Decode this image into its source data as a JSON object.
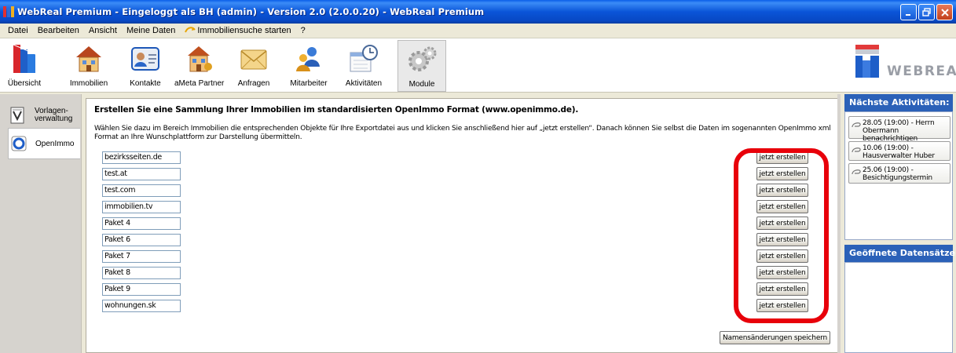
{
  "window": {
    "title": "WebReal Premium - Eingeloggt als  BH (admin) - Version 2.0 (2.0.0.20) - WebReal Premium",
    "controls": [
      "minimize",
      "maximize",
      "close"
    ]
  },
  "menu": {
    "items": [
      "Datei",
      "Bearbeiten",
      "Ansicht",
      "Meine Daten",
      "Immobiliensuche starten",
      "?"
    ]
  },
  "toolbar": {
    "items": [
      {
        "label": "Übersicht",
        "icon": "overview-icon"
      },
      {
        "label": "Immobilien",
        "icon": "house-icon"
      },
      {
        "label": "Kontakte",
        "icon": "contact-card-icon"
      },
      {
        "label": "aMeta Partner",
        "icon": "partner-building-icon"
      },
      {
        "label": "Anfragen",
        "icon": "envelope-icon"
      },
      {
        "label": "Mitarbeiter",
        "icon": "staff-icon"
      },
      {
        "label": "Aktivitäten",
        "icon": "calendar-clock-icon"
      },
      {
        "label": "Module",
        "icon": "gears-icon"
      }
    ],
    "active": "Module"
  },
  "logo": {
    "text": "WEBREAL"
  },
  "sidebar": {
    "items": [
      {
        "label": "Vorlagen-\nverwaltung",
        "icon": "template-icon"
      },
      {
        "label": "OpenImmo",
        "icon": "openimmo-icon"
      }
    ],
    "selected": "OpenImmo"
  },
  "main": {
    "heading": "Erstellen Sie eine Sammlung Ihrer Immobilien im standardisierten OpenImmo Format (www.openimmo.de).",
    "description": "Wählen Sie dazu im Bereich Immobilien die entsprechenden Objekte für Ihre Exportdatei aus und klicken Sie anschließend hier auf „jetzt erstellen“. Danach können Sie selbst die Daten im sogenannten OpenImmo xml Format  an Ihre Wunschplattform zur Darstellung übermitteln.",
    "packages": [
      {
        "name": "bezirksseiten.de",
        "button": "jetzt erstellen"
      },
      {
        "name": "test.at",
        "button": "jetzt erstellen"
      },
      {
        "name": "test.com",
        "button": "jetzt erstellen"
      },
      {
        "name": "immobilien.tv",
        "button": "jetzt erstellen"
      },
      {
        "name": "Paket 4",
        "button": "jetzt erstellen"
      },
      {
        "name": "Paket 6",
        "button": "jetzt erstellen"
      },
      {
        "name": "Paket 7",
        "button": "jetzt erstellen"
      },
      {
        "name": "Paket 8",
        "button": "jetzt erstellen"
      },
      {
        "name": "Paket 9",
        "button": "jetzt erstellen"
      },
      {
        "name": "wohnungen.sk",
        "button": "jetzt erstellen"
      }
    ],
    "save_label": "Namensänderungen speichern"
  },
  "right": {
    "activities_title": "Nächste Aktivitäten:",
    "activities": [
      "28.05 (19:00) - Herrn Obermann benachrichtigen",
      "10.06 (19:00) - Hausverwalter Huber",
      "25.06 (19:00) - Besichtigungstermin"
    ],
    "records_title": "Geöffnete Datensätze:"
  },
  "colors": {
    "titlebar": "#0A55D8",
    "highlight": "#E8000A",
    "panel_header": "#2B61B8"
  }
}
